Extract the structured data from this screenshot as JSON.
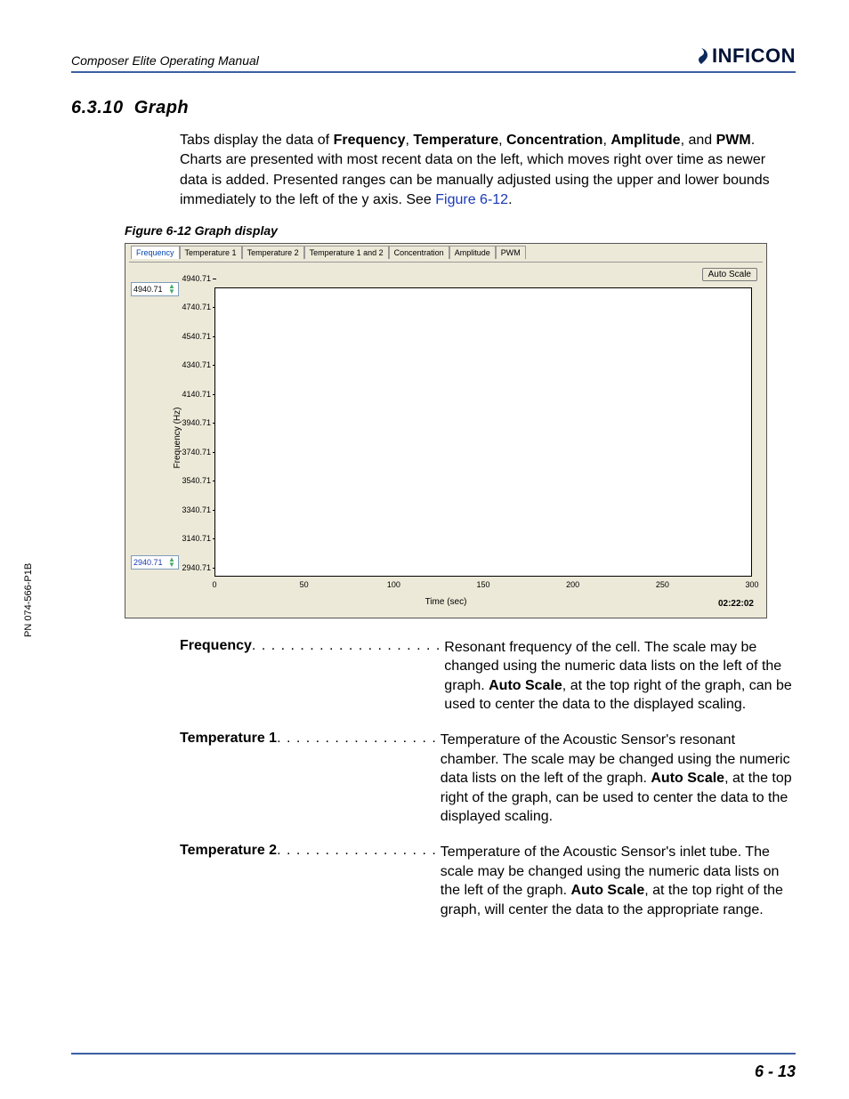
{
  "header": {
    "manual_title": "Composer Elite Operating Manual",
    "brand": "INFICON"
  },
  "section": {
    "number": "6.3.10",
    "title": "Graph"
  },
  "body": {
    "intro_pre": "Tabs display the data of ",
    "b1": "Frequency",
    "s1": ", ",
    "b2": "Temperature",
    "s2": ", ",
    "b3": "Concentration",
    "s3": ", ",
    "b4": "Amplitude",
    "s4": ", and ",
    "b5": "PWM",
    "intro_post": ". Charts are presented with most recent data on the left, which moves right over time as newer data is added. Presented ranges can be manually adjusted using the upper and lower bounds immediately to the left of the y axis. See ",
    "figref": "Figure 6-12",
    "intro_end": "."
  },
  "figure_caption": "Figure 6-12  Graph display",
  "chart": {
    "tabs": [
      "Frequency",
      "Temperature 1",
      "Temperature 2",
      "Temperature 1 and 2",
      "Concentration",
      "Amplitude",
      "PWM"
    ],
    "active_tab": 0,
    "autoscale_label": "Auto Scale",
    "timestamp": "02:22:02",
    "upper_bound": "4940.71",
    "lower_bound": "2940.71"
  },
  "chart_data": {
    "type": "line",
    "title": "",
    "xlabel": "Time (sec)",
    "ylabel": "Frequency (Hz)",
    "xlim": [
      0,
      300
    ],
    "ylim": [
      2940.71,
      4940.71
    ],
    "x_ticks": [
      0,
      50,
      100,
      150,
      200,
      250,
      300
    ],
    "y_ticks": [
      2940.71,
      3140.71,
      3340.71,
      3540.71,
      3740.71,
      3940.71,
      4140.71,
      4340.71,
      4540.71,
      4740.71,
      4940.71
    ],
    "series": [
      {
        "name": "Frequency",
        "x": [],
        "y": []
      }
    ]
  },
  "defs": [
    {
      "term": "Frequency",
      "dots": " . . . . . . . . . . . . . . . . . . . .",
      "def": "Resonant frequency of the cell. The scale may be changed using the numeric data lists on the left of the graph. <b>Auto Scale</b>, at the top right of the graph, can be used to center the data to the displayed scaling."
    },
    {
      "term": "Temperature 1",
      "dots": ". . . . . . . . . . . . . . . . .",
      "def": "Temperature of the Acoustic Sensor's resonant chamber. The scale may be changed using the numeric data lists on the left of the graph. <b>Auto Scale</b>, at the top right of the graph, can be used to center the data to the displayed scaling."
    },
    {
      "term": "Temperature 2",
      "dots": ". . . . . . . . . . . . . . . . .",
      "def": "Temperature of the Acoustic Sensor's inlet tube. The scale may be changed using the numeric data lists on the left of the graph. <b>Auto Scale</b>, at the top right of the graph, will center the data to the appropriate range."
    }
  ],
  "side_pn": "PN 074-566-P1B",
  "page_number": "6 - 13"
}
